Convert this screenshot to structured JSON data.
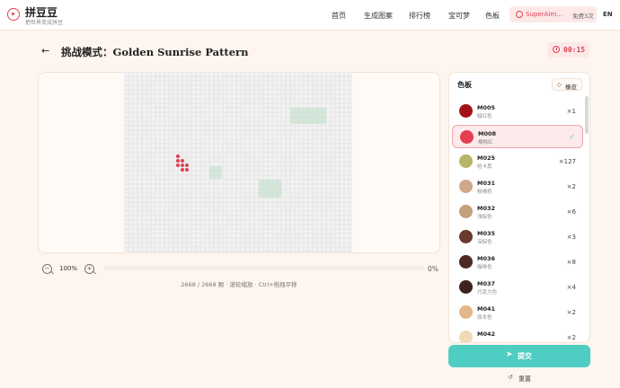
{
  "brand": {
    "title": "拼豆豆",
    "subtitle": "把世界变成拼豆"
  },
  "nav": {
    "items": [
      "首页",
      "生成图案",
      "排行榜",
      "宝可梦",
      "色板"
    ],
    "user_name": "SuperAIm…",
    "free_count": "免费3次",
    "lang": "EN"
  },
  "challenge": {
    "back_icon": "arrow-left-icon",
    "title": "挑战模式：Golden Sunrise Pattern",
    "timer": "00:15"
  },
  "canvas": {
    "zoom_out": "−",
    "zoom_in": "+",
    "zoom_level": "100%",
    "progress_percent": "0%",
    "progress_value": 0,
    "info": "2668 / 2668 颗 · 滚轮缩放 · Ctrl+拖拽平移"
  },
  "palette": {
    "title": "色板",
    "eraser_label": "橡皮",
    "colors": [
      {
        "code": "M005",
        "name": "暗红色",
        "count": "×1",
        "color": "#a3121a"
      },
      {
        "code": "M008",
        "name": "樱桃红",
        "count": "",
        "color": "#e23f52",
        "selected": true
      },
      {
        "code": "M025",
        "name": "哈卡其",
        "count": "×127",
        "color": "#b6b56a"
      },
      {
        "code": "M031",
        "name": "粉褐色",
        "count": "×2",
        "color": "#d1a98a"
      },
      {
        "code": "M032",
        "name": "浅棕色",
        "count": "×6",
        "color": "#c4a07c"
      },
      {
        "code": "M035",
        "name": "深棕色",
        "count": "×3",
        "color": "#6b3a2e"
      },
      {
        "code": "M036",
        "name": "咖啡色",
        "count": "×8",
        "color": "#4c2a23"
      },
      {
        "code": "M037",
        "name": "巧克力色",
        "count": "×4",
        "color": "#3d221d"
      },
      {
        "code": "M041",
        "name": "原木色",
        "count": "×2",
        "color": "#e2b888"
      },
      {
        "code": "M042",
        "name": "",
        "count": "×2",
        "color": "#f2d9b5"
      }
    ],
    "selected_check": "✓"
  },
  "actions": {
    "submit_label": "提交",
    "reset_label": "重置"
  }
}
